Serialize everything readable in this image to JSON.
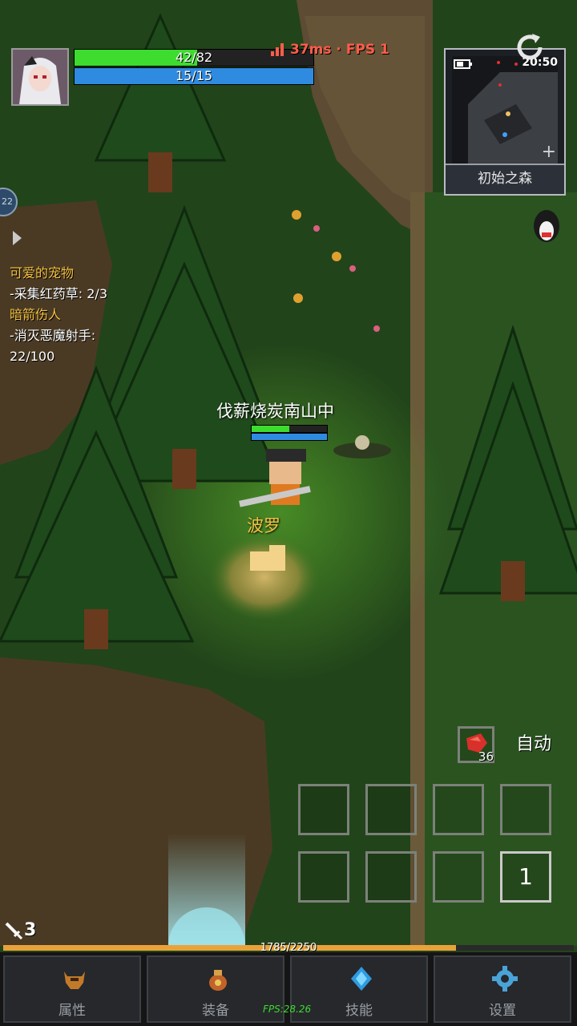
{
  "hud": {
    "hp_text": "42/82",
    "hp_fraction": 0.512,
    "mp_text": "15/15",
    "mp_fraction": 1.0,
    "ping": "37ms · FPS 1",
    "clock": "20:50",
    "map_name": "初始之森",
    "side_badge": "22",
    "attack_count": "3"
  },
  "quests": [
    {
      "title": "可爱的宠物",
      "detail": "-采集红药草: 2/3"
    },
    {
      "title": "暗箭伤人",
      "detail": "-消灭恶魔射手:",
      "progress": "22/100"
    }
  ],
  "world": {
    "player_name": "伐薪烧炭南山中",
    "pet_name": "波罗",
    "player_hp_fraction": 0.5,
    "player_mp_fraction": 1.0
  },
  "actions": {
    "potion_count": "36",
    "auto_label": "自动",
    "skill_page": "1"
  },
  "xp": {
    "text": "1785/2250",
    "fraction": 0.793
  },
  "nav": {
    "attributes": "属性",
    "equipment": "装备",
    "skills": "技能",
    "settings": "设置"
  },
  "debug_fps": "FPS:28.26",
  "colors": {
    "hp": "#3ddc2f",
    "mp": "#2f8be0",
    "quest_title": "#f5c242",
    "ping": "#ff5d4a",
    "pet_name": "#f5c242",
    "xp": "#e9a23b"
  }
}
